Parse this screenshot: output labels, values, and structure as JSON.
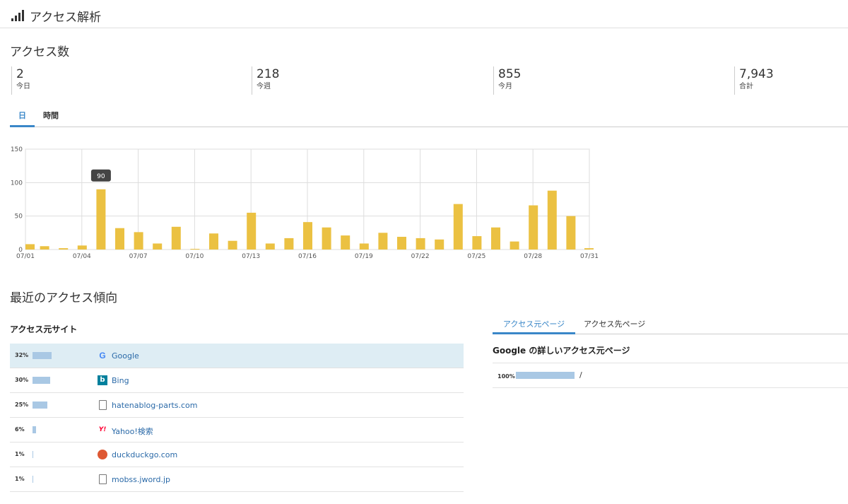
{
  "header": {
    "title": "アクセス解析",
    "icon": "signal-bars-icon"
  },
  "access": {
    "title": "アクセス数",
    "stats": [
      {
        "value": "2",
        "label": "今日"
      },
      {
        "value": "218",
        "label": "今週"
      },
      {
        "value": "855",
        "label": "今月"
      },
      {
        "value": "7,943",
        "label": "合計"
      }
    ],
    "tabs": [
      "日",
      "時間"
    ],
    "active_tab": "日"
  },
  "chart_data": {
    "type": "bar",
    "categories": [
      "07/01",
      "07/02",
      "07/03",
      "07/04",
      "07/05",
      "07/06",
      "07/07",
      "07/08",
      "07/09",
      "07/10",
      "07/11",
      "07/12",
      "07/13",
      "07/14",
      "07/15",
      "07/16",
      "07/17",
      "07/18",
      "07/19",
      "07/20",
      "07/21",
      "07/22",
      "07/23",
      "07/24",
      "07/25",
      "07/26",
      "07/27",
      "07/28",
      "07/29",
      "07/30",
      "07/31"
    ],
    "values": [
      8,
      5,
      2,
      6,
      90,
      32,
      26,
      9,
      34,
      1,
      24,
      13,
      55,
      9,
      17,
      41,
      33,
      21,
      9,
      25,
      19,
      17,
      15,
      68,
      20,
      33,
      12,
      66,
      88,
      50,
      2
    ],
    "tick_labels": [
      "07/01",
      "07/04",
      "07/07",
      "07/10",
      "07/13",
      "07/16",
      "07/19",
      "07/22",
      "07/25",
      "07/28",
      "07/31"
    ],
    "yticks": [
      "0",
      "50",
      "100",
      "150"
    ],
    "ylim": [
      0,
      150
    ],
    "tooltip": {
      "category": "07/05",
      "label": "90"
    },
    "bar_color": "#ebc142",
    "grid": true
  },
  "trends": {
    "title": "最近のアクセス傾向",
    "sources_title": "アクセス元サイト",
    "sources": [
      {
        "percent": "32%",
        "share": 0.32,
        "name": "Google",
        "icon": "google-icon"
      },
      {
        "percent": "30%",
        "share": 0.3,
        "name": "Bing",
        "icon": "bing-icon"
      },
      {
        "percent": "25%",
        "share": 0.25,
        "name": "hatenablog-parts.com",
        "icon": "page-icon"
      },
      {
        "percent": "6%",
        "share": 0.06,
        "name": "Yahoo!検索",
        "icon": "yahoo-icon"
      },
      {
        "percent": "1%",
        "share": 0.01,
        "name": "duckduckgo.com",
        "icon": "duckduckgo-icon"
      },
      {
        "percent": "1%",
        "share": 0.01,
        "name": "mobss.jword.jp",
        "icon": "page-icon"
      }
    ],
    "page_tabs": [
      "アクセス元ページ",
      "アクセス先ページ"
    ],
    "detail_title": "Google の詳しいアクセス元ページ",
    "detail_rows": [
      {
        "percent": "100%",
        "share": 1.0,
        "path": "/"
      }
    ]
  },
  "colors": {
    "accent": "#3a87c8",
    "bar": "#ebc142",
    "source_bar": "#a9c8e4",
    "selected_row": "#deedf4"
  }
}
